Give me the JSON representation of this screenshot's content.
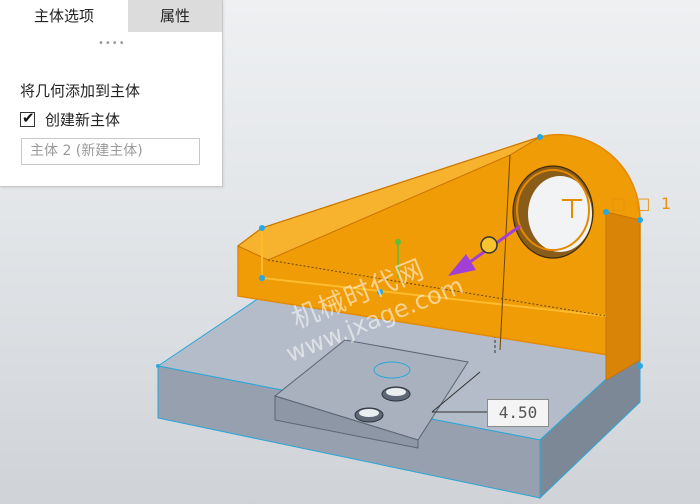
{
  "panel": {
    "tabs": [
      {
        "label": "主体选项",
        "active": true
      },
      {
        "label": "属性",
        "active": false
      }
    ],
    "grip": "••••",
    "section_label": "将几何添加到主体",
    "create_new_body": {
      "label": "创建新主体",
      "checked": true,
      "check_glyph": "✔"
    },
    "body_name_field": {
      "value": "主体 2 (新建主体)"
    }
  },
  "viewport": {
    "selection_indicator": {
      "boxes": "□ □",
      "count": "1"
    },
    "dimension_value": "4.50",
    "watermark": {
      "line1": "机械时代网",
      "line2": "www.jxage.com"
    },
    "colors": {
      "orange_body": "#f09c06",
      "orange_edge": "#e58a00",
      "base_gray": "#9ca6b4",
      "pull_arrow": "#a23fd6",
      "vertex": "#29a8e0"
    }
  }
}
